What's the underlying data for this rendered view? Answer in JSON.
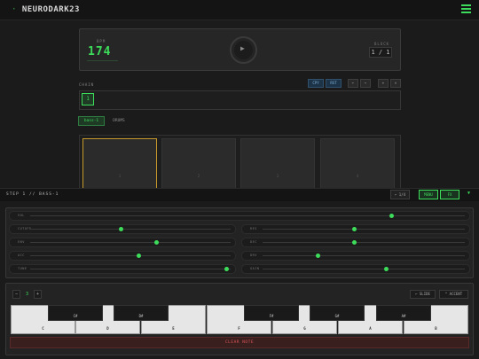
{
  "app": {
    "title": "NEURODARK23",
    "led": "·"
  },
  "transport": {
    "bpm_label": "BPM",
    "bpm": "174",
    "play_icon": "▶",
    "block_label": "BLOCK",
    "block": "1 / 1"
  },
  "chain": {
    "label": "CHAIN",
    "buttons": [
      "CPY",
      "RST",
      "←",
      "→",
      "+",
      "×"
    ],
    "items": [
      "1"
    ]
  },
  "tabs": [
    "bass-1",
    "DRUMS"
  ],
  "pads": [
    "1",
    "2",
    "3",
    "4"
  ],
  "step": {
    "label": "STEP 1 // BASS-1",
    "buttons": [
      "← 1/4",
      "MENU",
      "FX"
    ],
    "caret": "▼"
  },
  "params": {
    "full": {
      "label": "VOL",
      "value": 0.83
    },
    "left": [
      {
        "label": "CUTOFF",
        "value": 0.45
      },
      {
        "label": "ENV",
        "value": 0.63
      },
      {
        "label": "ACC",
        "value": 0.54
      },
      {
        "label": "TUNE",
        "value": 0.98
      }
    ],
    "right": [
      {
        "label": "RES",
        "value": 0.45
      },
      {
        "label": "DEC",
        "value": 0.45
      },
      {
        "label": "DRV",
        "value": 0.27
      },
      {
        "label": "GAIN",
        "value": 0.61
      }
    ]
  },
  "keyboard": {
    "octave_minus": "−",
    "octave": "3",
    "octave_plus": "+",
    "slide": "← SLIDE",
    "accent": "^ ACCENT",
    "white_keys": [
      "C",
      "D",
      "E",
      "F",
      "G",
      "A",
      "B"
    ],
    "black_keys": [
      "C#",
      "D#",
      "F#",
      "G#",
      "A#"
    ],
    "clear": "CLEAR NOTE"
  },
  "colors": {
    "accent": "#3ddc5a",
    "selected_pad": "#c69a2a",
    "danger": "#e05555"
  }
}
